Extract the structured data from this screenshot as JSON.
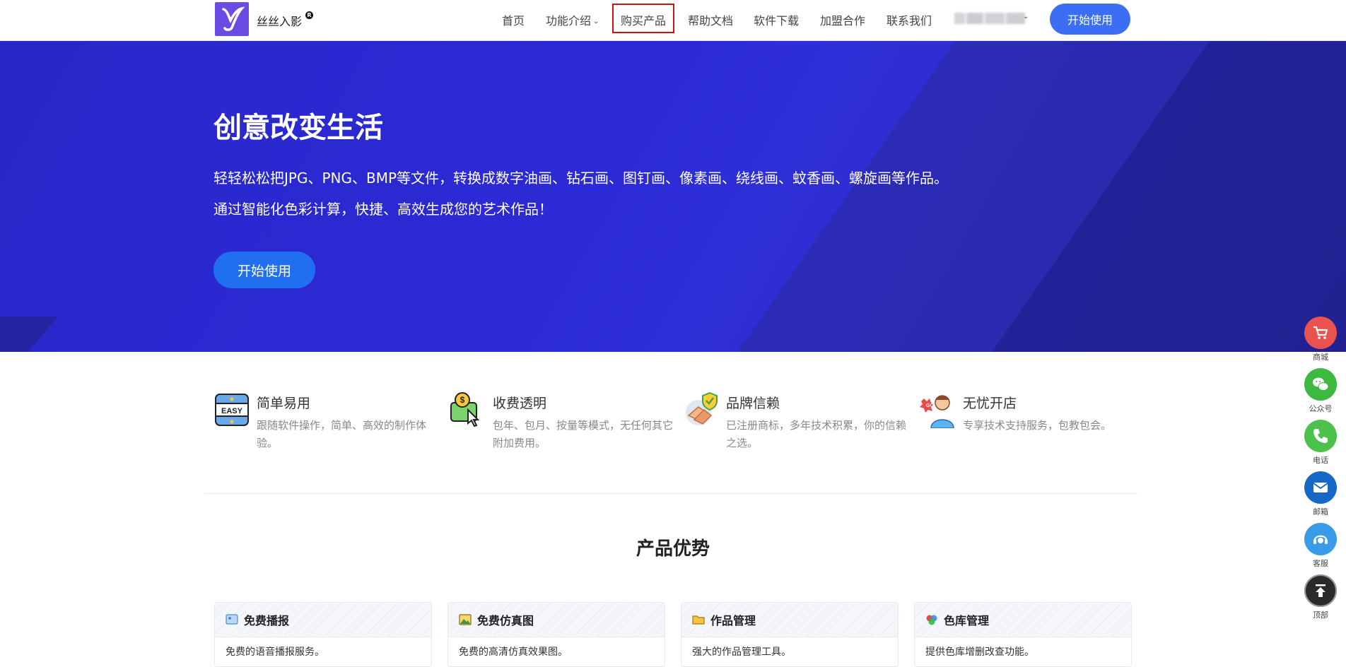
{
  "header": {
    "brand": "丝丝入影",
    "registered_mark": "R",
    "nav": [
      {
        "label": "首页"
      },
      {
        "label": "功能介绍"
      },
      {
        "label": "购买产品"
      },
      {
        "label": "帮助文档"
      },
      {
        "label": "软件下载"
      },
      {
        "label": "加盟合作"
      },
      {
        "label": "联系我们"
      }
    ],
    "cta": "开始使用"
  },
  "hero": {
    "title": "创意改变生活",
    "line1": "轻轻松松把JPG、PNG、BMP等文件，转换成数字油画、钻石画、图钉画、像素画、绕线画、蚊香画、螺旋画等作品。",
    "line2": "通过智能化色彩计算，快捷、高效生成您的艺术作品！",
    "cta": "开始使用"
  },
  "features": [
    {
      "title": "简单易用",
      "desc": "跟随软件操作，简单、高效的制作体验。",
      "icon": "easy-icon"
    },
    {
      "title": "收费透明",
      "desc": "包年、包月、按量等模式，无任何其它附加费用。",
      "icon": "coin-click-icon"
    },
    {
      "title": "品牌信赖",
      "desc": "已注册商标，多年技术积累，你的信赖之选。",
      "icon": "handshake-shield-icon"
    },
    {
      "title": "无忧开店",
      "desc": "专享技术支持服务，包教包会。",
      "icon": "support-person-icon"
    }
  ],
  "section": {
    "title": "产品优势"
  },
  "cards": [
    {
      "title": "免费播报",
      "desc": "免费的语音播报服务。",
      "icon": "broadcast-icon"
    },
    {
      "title": "免费仿真图",
      "desc": "免费的高清仿真效果图。",
      "icon": "picture-icon"
    },
    {
      "title": "作品管理",
      "desc": "强大的作品管理工具。",
      "icon": "folder-icon"
    },
    {
      "title": "色库管理",
      "desc": "提供色库增删改查功能。",
      "icon": "color-palette-icon"
    }
  ],
  "floating": [
    {
      "label": "商城",
      "color": "#e9534f",
      "icon": "cart-icon"
    },
    {
      "label": "公众号",
      "color": "#3fb83f",
      "icon": "wechat-icon"
    },
    {
      "label": "电话",
      "color": "#4cc24c",
      "icon": "phone-icon"
    },
    {
      "label": "邮箱",
      "color": "#1668c7",
      "icon": "mail-icon"
    },
    {
      "label": "客服",
      "color": "#3a9be8",
      "icon": "customer-service-icon"
    },
    {
      "label": "顶部",
      "color": "#2b2b2b",
      "icon": "back-to-top-icon"
    }
  ],
  "colors": {
    "hero_bg": "#2b2ad6",
    "primary": "#3b6ef5",
    "active_outline": "#d01010"
  }
}
